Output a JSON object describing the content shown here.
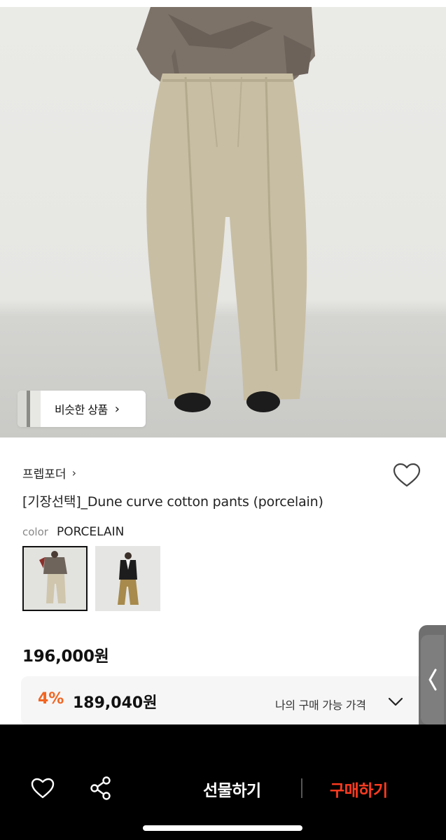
{
  "hero": {
    "similar_products_label": "비슷한 상품"
  },
  "product": {
    "brand": "프렙포더",
    "title": "[기장선택]_Dune curve cotton pants (porcelain)",
    "color_label": "color",
    "color_value": "PORCELAIN",
    "price": "196,000원"
  },
  "my_price": {
    "discount": "4%",
    "amount": "189,040원",
    "label": "나의 구매 가능 가격"
  },
  "bottom_bar": {
    "gift_label": "선물하기",
    "buy_label": "구매하기"
  },
  "colors": {
    "accent_orange": "#f26522",
    "buy_red": "#ff3b1f",
    "bar_background": "#000000"
  },
  "icons": {
    "wish": "heart-outline-icon",
    "share": "share-icon",
    "chevron": "chevron-right-icon",
    "dropdown": "chevron-down-icon",
    "side_tab": "chevron-left-icon"
  }
}
